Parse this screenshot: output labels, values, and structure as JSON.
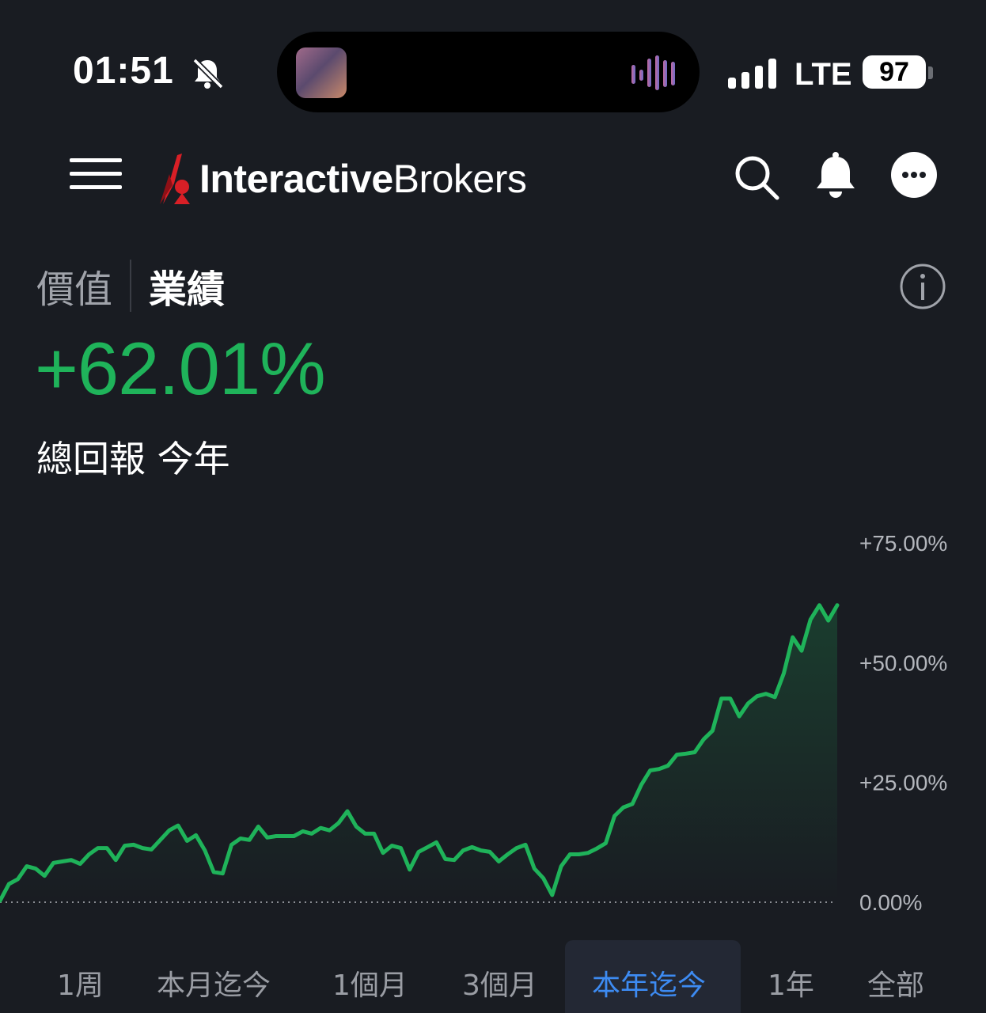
{
  "status_bar": {
    "time": "01:51",
    "network": "LTE",
    "battery": "97"
  },
  "app": {
    "logo_bold": "Interactive",
    "logo_regular": "Brokers"
  },
  "tabs": {
    "value_label": "價值",
    "performance_label": "業績"
  },
  "summary": {
    "total_return": "+62.01%",
    "subtitle": "總回報 今年"
  },
  "colors": {
    "positive": "#1fb35a",
    "accent": "#3d8bf2",
    "background": "#191c22"
  },
  "chart_data": {
    "type": "area",
    "ylim": [
      0,
      75
    ],
    "y_ticks": [
      "+75.00%",
      "+50.00%",
      "+25.00%",
      "0.00%"
    ],
    "y_tick_values": [
      75,
      50,
      25,
      0
    ],
    "x": [
      0,
      1,
      2,
      3,
      4,
      5,
      6,
      7,
      8,
      9,
      10,
      11,
      12,
      13,
      14,
      15,
      16,
      17,
      18,
      19,
      20,
      21,
      22,
      23,
      24,
      25,
      26,
      27,
      28,
      29,
      30,
      31,
      32,
      33,
      34,
      35,
      36,
      37,
      38,
      39,
      40,
      41,
      42,
      43,
      44,
      45,
      46,
      47,
      48,
      49,
      50,
      51,
      52,
      53,
      54,
      55,
      56,
      57,
      58,
      59,
      60,
      61,
      62,
      63,
      64,
      65,
      66,
      67,
      68,
      69,
      70,
      71,
      72,
      73,
      74,
      75,
      76,
      77,
      78,
      79,
      80,
      81,
      82,
      83,
      84,
      85,
      86,
      87,
      88,
      89,
      90,
      91,
      92,
      93,
      94,
      95,
      96,
      97,
      98,
      99,
      100,
      101,
      102,
      103,
      104,
      105,
      106,
      107,
      108,
      109
    ],
    "values": [
      0.3,
      3.8,
      4.8,
      7.5,
      7.0,
      5.5,
      8.2,
      8.5,
      8.8,
      8.0,
      10.0,
      11.3,
      11.3,
      8.8,
      11.8,
      12.0,
      11.3,
      11.0,
      13.0,
      15.0,
      16.0,
      12.8,
      14.0,
      10.8,
      6.3,
      6.0,
      12.0,
      13.3,
      13.0,
      15.8,
      13.5,
      13.8,
      13.8,
      13.8,
      14.8,
      14.3,
      15.5,
      15.0,
      16.5,
      19.0,
      15.8,
      14.3,
      14.3,
      10.3,
      11.8,
      11.3,
      6.8,
      10.5,
      11.5,
      12.5,
      9.0,
      8.8,
      10.8,
      11.5,
      10.8,
      10.5,
      8.5,
      10.0,
      11.3,
      12.0,
      7.0,
      5.0,
      1.5,
      7.5,
      10.0,
      10.0,
      10.3,
      11.2,
      12.3,
      18.0,
      19.8,
      20.5,
      24.5,
      27.5,
      27.8,
      28.5,
      30.8,
      31.0,
      31.3,
      34.0,
      35.8,
      42.5,
      42.5,
      38.8,
      41.5,
      43.0,
      43.5,
      42.8,
      47.8,
      55.3,
      52.5,
      59.0,
      62.0,
      58.8,
      62.0
    ],
    "grid": false,
    "baseline": 0
  },
  "ranges": {
    "items": [
      "1周",
      "本月迄今",
      "1個月",
      "3個月",
      "本年迄今",
      "1年",
      "全部"
    ],
    "selected": "本年迄今"
  }
}
